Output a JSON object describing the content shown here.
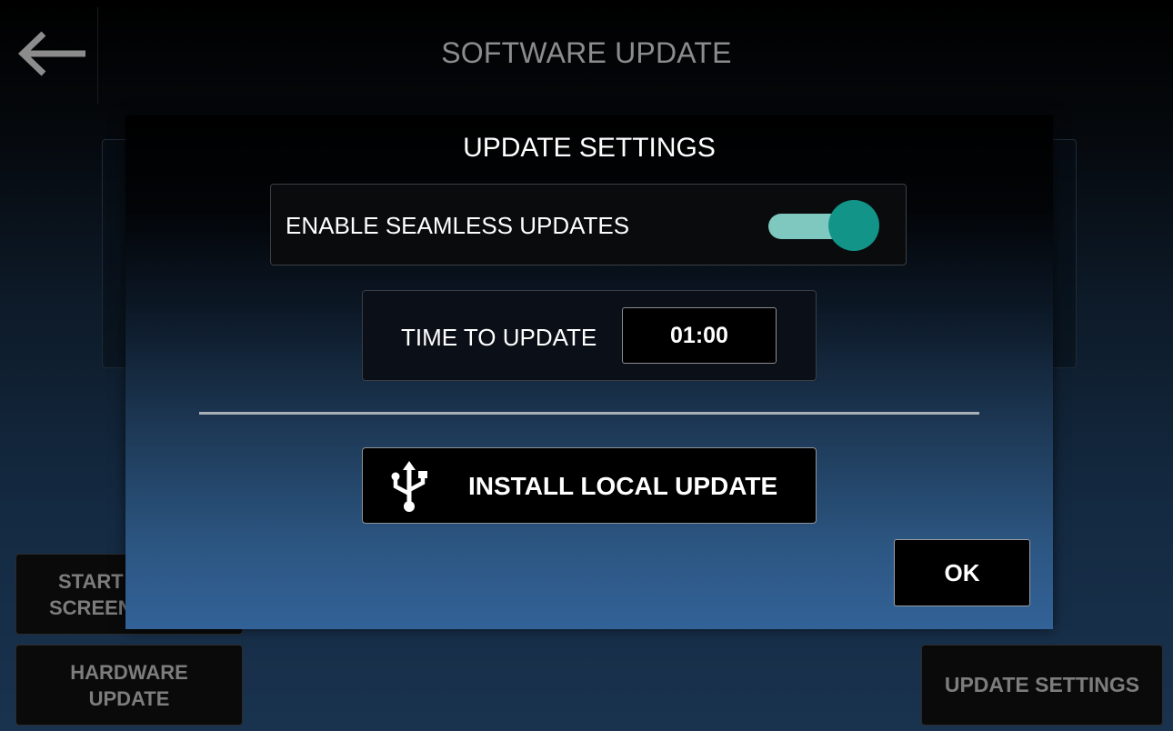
{
  "page": {
    "title": "SOFTWARE UPDATE",
    "back_icon": "left-arrow-icon"
  },
  "bottom_buttons": {
    "start_screen_line1": "START",
    "start_screen_line2": "SCREEN",
    "hardware_update_line1": "HARDWARE",
    "hardware_update_line2": "UPDATE",
    "update_settings": "UPDATE SETTINGS"
  },
  "dialog": {
    "title": "UPDATE SETTINGS",
    "seamless": {
      "label": "ENABLE SEAMLESS UPDATES",
      "enabled": true
    },
    "time": {
      "label": "TIME TO UPDATE",
      "value": "01:00"
    },
    "install": {
      "label": "INSTALL LOCAL UPDATE",
      "icon": "usb-icon"
    },
    "ok_label": "OK"
  },
  "colors": {
    "toggle_knob": "#139488",
    "toggle_track": "#7fc8c0"
  }
}
